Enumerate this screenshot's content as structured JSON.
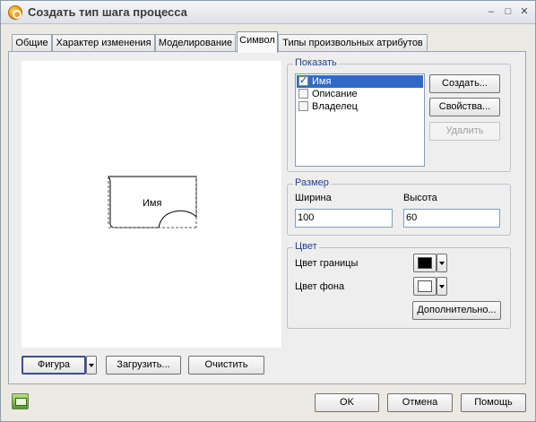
{
  "window": {
    "title": "Создать тип шага процесса",
    "minimize_glyph": "–",
    "maximize_glyph": "□",
    "close_glyph": "✕"
  },
  "tabs": [
    {
      "label": "Общие"
    },
    {
      "label": "Характер изменения"
    },
    {
      "label": "Моделирование"
    },
    {
      "label": "Символ",
      "active": true
    },
    {
      "label": "Типы произвольных атрибутов"
    }
  ],
  "preview": {
    "shape_label": "Имя"
  },
  "bottom_buttons": {
    "figure": "Фигура",
    "load": "Загрузить...",
    "clear": "Очистить"
  },
  "show_group": {
    "title": "Показать",
    "items": [
      {
        "label": "Имя",
        "checked": true,
        "selected": true
      },
      {
        "label": "Описание",
        "checked": false,
        "selected": false
      },
      {
        "label": "Владелец",
        "checked": false,
        "selected": false
      }
    ],
    "create": "Создать...",
    "properties": "Свойства...",
    "delete": "Удалить"
  },
  "size_group": {
    "title": "Размер",
    "width_label": "Ширина",
    "width_value": "100",
    "height_label": "Высота",
    "height_value": "60"
  },
  "color_group": {
    "title": "Цвет",
    "border_label": "Цвет границы",
    "border_color": "#000000",
    "fill_label": "Цвет фона",
    "fill_color": "#ffffff",
    "more": "Дополнительно..."
  },
  "dialog_buttons": {
    "ok": "OK",
    "cancel": "Отмена",
    "help": "Помощь"
  }
}
